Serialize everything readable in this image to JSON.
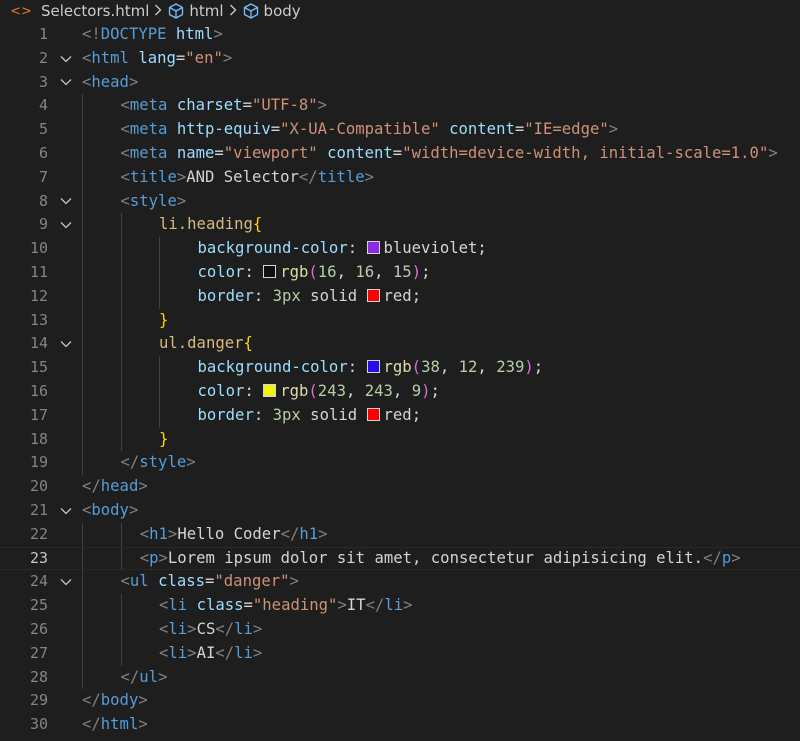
{
  "breadcrumb": {
    "file": "Selectors.html",
    "items": [
      "html",
      "body"
    ],
    "lead_icon": "<>"
  },
  "editor": {
    "current_line": 23,
    "lines": [
      {
        "n": 1,
        "indent": 0,
        "fold": false,
        "tokens": [
          [
            "br",
            "<!"
          ],
          [
            "tag",
            "DOCTYPE"
          ],
          [
            "txt",
            " "
          ],
          [
            "attr",
            "html"
          ],
          [
            "br",
            ">"
          ]
        ]
      },
      {
        "n": 2,
        "indent": 0,
        "fold": true,
        "tokens": [
          [
            "br",
            "<"
          ],
          [
            "tag",
            "html"
          ],
          [
            "txt",
            " "
          ],
          [
            "attr",
            "lang"
          ],
          [
            "txt",
            "="
          ],
          [
            "str",
            "\"en\""
          ],
          [
            "br",
            ">"
          ]
        ]
      },
      {
        "n": 3,
        "indent": 0,
        "fold": true,
        "tokens": [
          [
            "br",
            "<"
          ],
          [
            "tag",
            "head"
          ],
          [
            "br",
            ">"
          ]
        ]
      },
      {
        "n": 4,
        "indent": 1,
        "fold": false,
        "tokens": [
          [
            "br",
            "<"
          ],
          [
            "tag",
            "meta"
          ],
          [
            "txt",
            " "
          ],
          [
            "attr",
            "charset"
          ],
          [
            "txt",
            "="
          ],
          [
            "str",
            "\"UTF-8\""
          ],
          [
            "br",
            ">"
          ]
        ]
      },
      {
        "n": 5,
        "indent": 1,
        "fold": false,
        "tokens": [
          [
            "br",
            "<"
          ],
          [
            "tag",
            "meta"
          ],
          [
            "txt",
            " "
          ],
          [
            "attr",
            "http-equiv"
          ],
          [
            "txt",
            "="
          ],
          [
            "str",
            "\"X-UA-Compatible\""
          ],
          [
            "txt",
            " "
          ],
          [
            "attr",
            "content"
          ],
          [
            "txt",
            "="
          ],
          [
            "str",
            "\"IE=edge\""
          ],
          [
            "br",
            ">"
          ]
        ]
      },
      {
        "n": 6,
        "indent": 1,
        "fold": false,
        "tokens": [
          [
            "br",
            "<"
          ],
          [
            "tag",
            "meta"
          ],
          [
            "txt",
            " "
          ],
          [
            "attr",
            "name"
          ],
          [
            "txt",
            "="
          ],
          [
            "str",
            "\"viewport\""
          ],
          [
            "txt",
            " "
          ],
          [
            "attr",
            "content"
          ],
          [
            "txt",
            "="
          ],
          [
            "str",
            "\"width=device-width, initial-scale=1.0\""
          ],
          [
            "br",
            ">"
          ]
        ]
      },
      {
        "n": 7,
        "indent": 1,
        "fold": false,
        "tokens": [
          [
            "br",
            "<"
          ],
          [
            "tag",
            "title"
          ],
          [
            "br",
            ">"
          ],
          [
            "txt",
            "AND Selector"
          ],
          [
            "br",
            "</"
          ],
          [
            "tag",
            "title"
          ],
          [
            "br",
            ">"
          ]
        ]
      },
      {
        "n": 8,
        "indent": 1,
        "fold": true,
        "tokens": [
          [
            "br",
            "<"
          ],
          [
            "tag",
            "style"
          ],
          [
            "br",
            ">"
          ]
        ]
      },
      {
        "n": 9,
        "indent": 2,
        "fold": true,
        "tokens": [
          [
            "sel",
            "li.heading"
          ],
          [
            "brk1",
            "{"
          ]
        ]
      },
      {
        "n": 10,
        "indent": 3,
        "fold": false,
        "tokens": [
          [
            "prop",
            "background-color"
          ],
          [
            "txt",
            ": "
          ],
          [
            "swatch",
            "#8a2be2"
          ],
          [
            "val",
            "blueviolet"
          ],
          [
            "txt",
            ";"
          ]
        ]
      },
      {
        "n": 11,
        "indent": 3,
        "fold": false,
        "tokens": [
          [
            "prop",
            "color"
          ],
          [
            "txt",
            ": "
          ],
          [
            "swatch",
            "#10100f"
          ],
          [
            "fn",
            "rgb"
          ],
          [
            "brk2",
            "("
          ],
          [
            "num",
            "16"
          ],
          [
            "txt",
            ", "
          ],
          [
            "num",
            "16"
          ],
          [
            "txt",
            ", "
          ],
          [
            "num",
            "15"
          ],
          [
            "brk2",
            ")"
          ],
          [
            "txt",
            ";"
          ]
        ]
      },
      {
        "n": 12,
        "indent": 3,
        "fold": false,
        "tokens": [
          [
            "prop",
            "border"
          ],
          [
            "txt",
            ": "
          ],
          [
            "num",
            "3px"
          ],
          [
            "txt",
            " solid "
          ],
          [
            "swatch",
            "#ff0000"
          ],
          [
            "val",
            "red"
          ],
          [
            "txt",
            ";"
          ]
        ]
      },
      {
        "n": 13,
        "indent": 2,
        "fold": false,
        "tokens": [
          [
            "brk1",
            "}"
          ]
        ]
      },
      {
        "n": 14,
        "indent": 2,
        "fold": true,
        "tokens": [
          [
            "sel",
            "ul.danger"
          ],
          [
            "brk1",
            "{"
          ]
        ]
      },
      {
        "n": 15,
        "indent": 3,
        "fold": false,
        "tokens": [
          [
            "prop",
            "background-color"
          ],
          [
            "txt",
            ": "
          ],
          [
            "swatch",
            "#260cef"
          ],
          [
            "fn",
            "rgb"
          ],
          [
            "brk2",
            "("
          ],
          [
            "num",
            "38"
          ],
          [
            "txt",
            ", "
          ],
          [
            "num",
            "12"
          ],
          [
            "txt",
            ", "
          ],
          [
            "num",
            "239"
          ],
          [
            "brk2",
            ")"
          ],
          [
            "txt",
            ";"
          ]
        ]
      },
      {
        "n": 16,
        "indent": 3,
        "fold": false,
        "tokens": [
          [
            "prop",
            "color"
          ],
          [
            "txt",
            ": "
          ],
          [
            "swatch",
            "#f3f309"
          ],
          [
            "fn",
            "rgb"
          ],
          [
            "brk2",
            "("
          ],
          [
            "num",
            "243"
          ],
          [
            "txt",
            ", "
          ],
          [
            "num",
            "243"
          ],
          [
            "txt",
            ", "
          ],
          [
            "num",
            "9"
          ],
          [
            "brk2",
            ")"
          ],
          [
            "txt",
            ";"
          ]
        ]
      },
      {
        "n": 17,
        "indent": 3,
        "fold": false,
        "tokens": [
          [
            "prop",
            "border"
          ],
          [
            "txt",
            ": "
          ],
          [
            "num",
            "3px"
          ],
          [
            "txt",
            " solid "
          ],
          [
            "swatch",
            "#ff0000"
          ],
          [
            "val",
            "red"
          ],
          [
            "txt",
            ";"
          ]
        ]
      },
      {
        "n": 18,
        "indent": 2,
        "fold": false,
        "tokens": [
          [
            "brk1",
            "}"
          ]
        ]
      },
      {
        "n": 19,
        "indent": 1,
        "fold": false,
        "tokens": [
          [
            "br",
            "</"
          ],
          [
            "tag",
            "style"
          ],
          [
            "br",
            ">"
          ]
        ]
      },
      {
        "n": 20,
        "indent": 0,
        "fold": false,
        "tokens": [
          [
            "br",
            "</"
          ],
          [
            "tag",
            "head"
          ],
          [
            "br",
            ">"
          ]
        ]
      },
      {
        "n": 21,
        "indent": 0,
        "fold": true,
        "tokens": [
          [
            "br",
            "<"
          ],
          [
            "tag",
            "body"
          ],
          [
            "br",
            ">"
          ]
        ]
      },
      {
        "n": 22,
        "indent": 1.5,
        "fold": false,
        "tokens": [
          [
            "br",
            "<"
          ],
          [
            "tag",
            "h1"
          ],
          [
            "br",
            ">"
          ],
          [
            "txt",
            "Hello Coder"
          ],
          [
            "br",
            "</"
          ],
          [
            "tag",
            "h1"
          ],
          [
            "br",
            ">"
          ]
        ]
      },
      {
        "n": 23,
        "indent": 1.5,
        "fold": false,
        "tokens": [
          [
            "br",
            "<"
          ],
          [
            "tag",
            "p"
          ],
          [
            "br",
            ">"
          ],
          [
            "txt",
            "Lorem ipsum dolor sit amet, consectetur adipisicing elit."
          ],
          [
            "br",
            "</"
          ],
          [
            "tag",
            "p"
          ],
          [
            "br",
            ">"
          ]
        ]
      },
      {
        "n": 24,
        "indent": 1,
        "fold": true,
        "tokens": [
          [
            "br",
            "<"
          ],
          [
            "tag",
            "ul"
          ],
          [
            "txt",
            " "
          ],
          [
            "attr",
            "class"
          ],
          [
            "txt",
            "="
          ],
          [
            "str",
            "\"danger\""
          ],
          [
            "br",
            ">"
          ]
        ]
      },
      {
        "n": 25,
        "indent": 2,
        "fold": false,
        "tokens": [
          [
            "br",
            "<"
          ],
          [
            "tag",
            "li"
          ],
          [
            "txt",
            " "
          ],
          [
            "attr",
            "class"
          ],
          [
            "txt",
            "="
          ],
          [
            "str",
            "\"heading\""
          ],
          [
            "br",
            ">"
          ],
          [
            "txt",
            "IT"
          ],
          [
            "br",
            "</"
          ],
          [
            "tag",
            "li"
          ],
          [
            "br",
            ">"
          ]
        ]
      },
      {
        "n": 26,
        "indent": 2,
        "fold": false,
        "tokens": [
          [
            "br",
            "<"
          ],
          [
            "tag",
            "li"
          ],
          [
            "br",
            ">"
          ],
          [
            "txt",
            "CS"
          ],
          [
            "br",
            "</"
          ],
          [
            "tag",
            "li"
          ],
          [
            "br",
            ">"
          ]
        ]
      },
      {
        "n": 27,
        "indent": 2,
        "fold": false,
        "tokens": [
          [
            "br",
            "<"
          ],
          [
            "tag",
            "li"
          ],
          [
            "br",
            ">"
          ],
          [
            "txt",
            "AI"
          ],
          [
            "br",
            "</"
          ],
          [
            "tag",
            "li"
          ],
          [
            "br",
            ">"
          ]
        ]
      },
      {
        "n": 28,
        "indent": 1,
        "fold": false,
        "tokens": [
          [
            "br",
            "</"
          ],
          [
            "tag",
            "ul"
          ],
          [
            "br",
            ">"
          ]
        ]
      },
      {
        "n": 29,
        "indent": 0,
        "fold": false,
        "tokens": [
          [
            "br",
            "</"
          ],
          [
            "tag",
            "body"
          ],
          [
            "br",
            ">"
          ]
        ]
      },
      {
        "n": 30,
        "indent": 0,
        "fold": false,
        "tokens": [
          [
            "br",
            "</"
          ],
          [
            "tag",
            "html"
          ],
          [
            "br",
            ">"
          ]
        ]
      }
    ]
  },
  "icons": {
    "file": "html-file-icon",
    "element": "cube-icon",
    "separator": "chevron-right-icon",
    "fold": "chevron-down-icon"
  },
  "colors": {
    "background": "#1e1e1e",
    "tag": "#569cd6",
    "attribute": "#9cdcfe",
    "string": "#ce9178",
    "selector": "#d7ba7d",
    "number": "#b5cea8",
    "function": "#dcdcaa"
  }
}
